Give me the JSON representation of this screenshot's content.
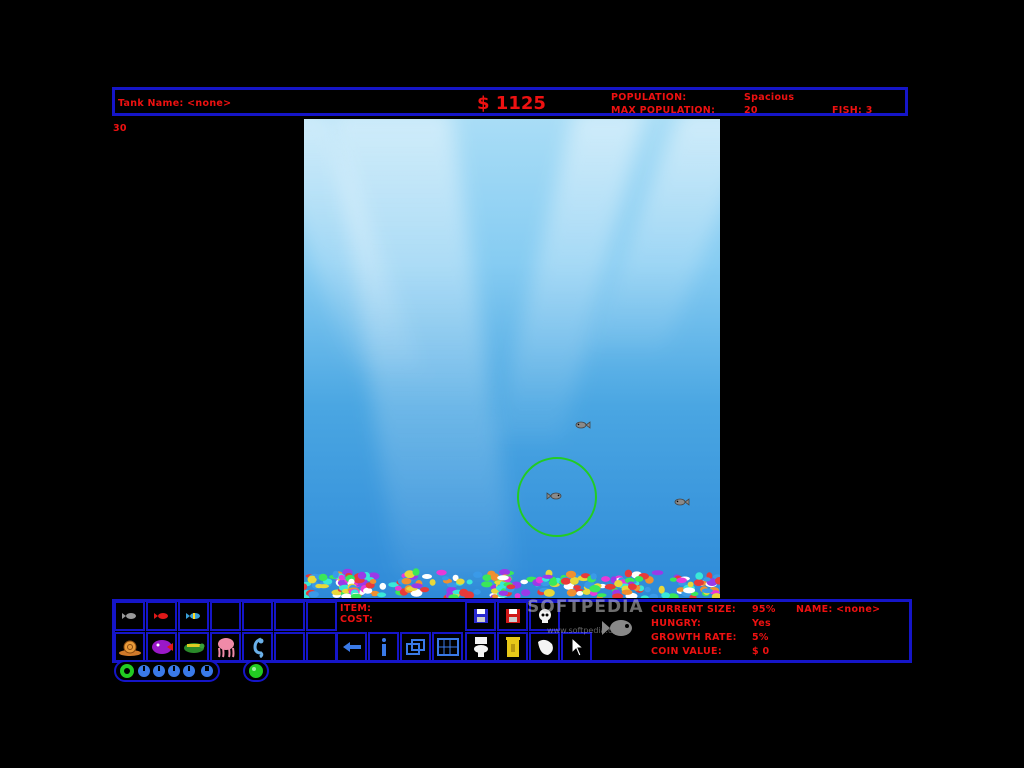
{
  "header": {
    "tank_name_label": "Tank Name: <none>",
    "money": "$ 1125",
    "population_label": "POPULATION:",
    "population_value": "Spacious",
    "max_population_label": "MAX POPULATION:",
    "max_population_value": "20",
    "fish_count": "FISH: 3",
    "fps": "30"
  },
  "item_panel": {
    "item_label": "ITEM:",
    "cost_label": "COST:"
  },
  "stats": {
    "current_size_label": "CURRENT SIZE:",
    "current_size_value": "95%",
    "name_label": "NAME: <none>",
    "hungry_label": "HUNGRY:",
    "hungry_value": "Yes",
    "growth_rate_label": "GROWTH RATE:",
    "growth_rate_value": "5%",
    "coin_value_label": "COIN VALUE:",
    "coin_value_value": "$ 0"
  },
  "watermark": {
    "brand": "SOFTPEDIA",
    "url": "www.softpedia.com"
  },
  "icons": {
    "row1": [
      "gray-fish-icon",
      "red-fish-icon",
      "striped-fish-icon"
    ],
    "row2": [
      "snail-icon",
      "purple-fish-icon",
      "turtle-icon",
      "jellyfish-icon",
      "seahorse-icon"
    ],
    "tools_row1": [
      "save-icon",
      "save-as-icon",
      "skull-icon"
    ],
    "tools_row2": [
      "back-arrow-icon",
      "info-icon",
      "tank-view-icon",
      "tank-grid-icon",
      "toilet-icon",
      "trash-can-icon",
      "net-icon",
      "cursor-icon"
    ]
  },
  "colors": {
    "border_blue": "#1515c8",
    "text_red": "#ee1111",
    "selection_green": "#22cc22"
  }
}
